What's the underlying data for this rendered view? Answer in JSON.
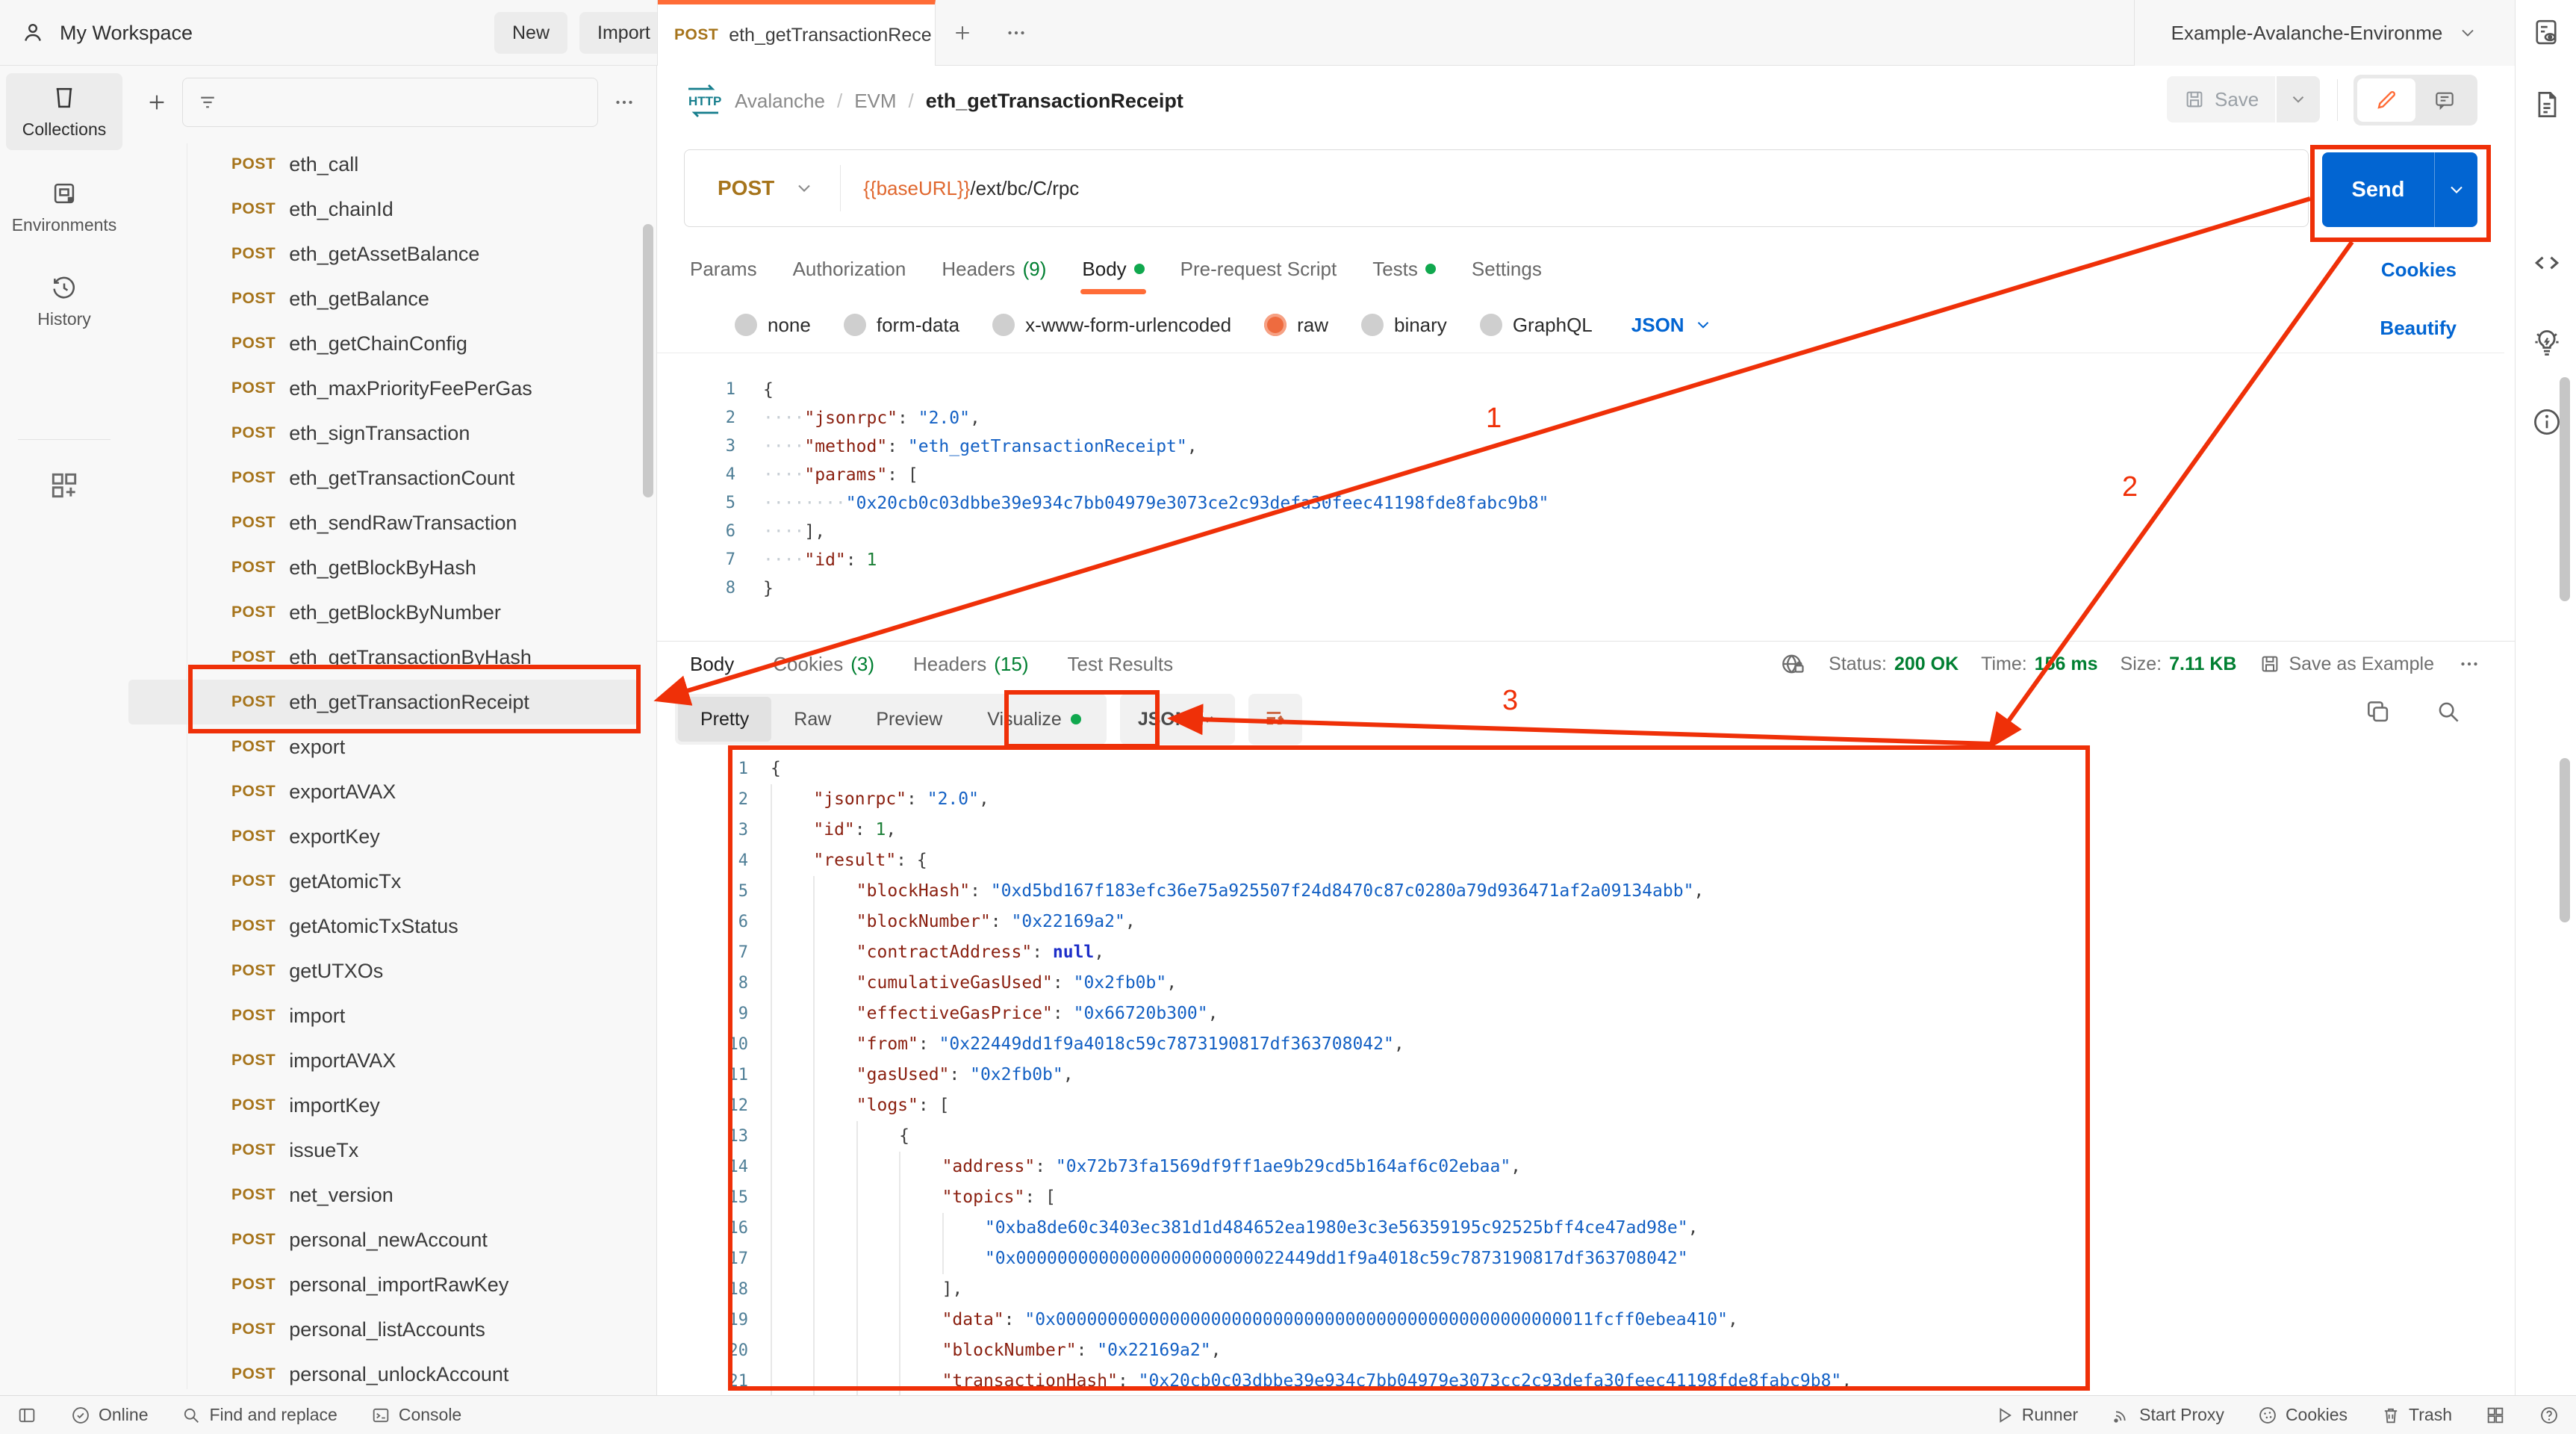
{
  "colors": {
    "accent_orange": "#ff6c37",
    "method_post_gold": "#a6741b",
    "link_blue": "#0265d2",
    "success_green": "#007f31",
    "dot_green": "#10a84e",
    "annotation_red": "#ef3008",
    "code_key": "#8a1f0f",
    "code_string": "#1360c4",
    "code_number": "#1b7f37",
    "code_null": "#1d2ec9"
  },
  "header": {
    "workspace_title": "My Workspace",
    "new_button": "New",
    "import_button": "Import",
    "active_tab": {
      "method": "POST",
      "title": "eth_getTransactionRece"
    },
    "environment": {
      "selected": "Example-Avalanche-Environme"
    }
  },
  "left_rail": {
    "collections": "Collections",
    "environments": "Environments",
    "history": "History"
  },
  "sidebar": {
    "selected_index": 12,
    "items": [
      {
        "method": "POST",
        "name": "eth_call"
      },
      {
        "method": "POST",
        "name": "eth_chainId"
      },
      {
        "method": "POST",
        "name": "eth_getAssetBalance"
      },
      {
        "method": "POST",
        "name": "eth_getBalance"
      },
      {
        "method": "POST",
        "name": "eth_getChainConfig"
      },
      {
        "method": "POST",
        "name": "eth_maxPriorityFeePerGas"
      },
      {
        "method": "POST",
        "name": "eth_signTransaction"
      },
      {
        "method": "POST",
        "name": "eth_getTransactionCount"
      },
      {
        "method": "POST",
        "name": "eth_sendRawTransaction"
      },
      {
        "method": "POST",
        "name": "eth_getBlockByHash"
      },
      {
        "method": "POST",
        "name": "eth_getBlockByNumber"
      },
      {
        "method": "POST",
        "name": "eth_getTransactionByHash"
      },
      {
        "method": "POST",
        "name": "eth_getTransactionReceipt"
      },
      {
        "method": "POST",
        "name": "export"
      },
      {
        "method": "POST",
        "name": "exportAVAX"
      },
      {
        "method": "POST",
        "name": "exportKey"
      },
      {
        "method": "POST",
        "name": "getAtomicTx"
      },
      {
        "method": "POST",
        "name": "getAtomicTxStatus"
      },
      {
        "method": "POST",
        "name": "getUTXOs"
      },
      {
        "method": "POST",
        "name": "import"
      },
      {
        "method": "POST",
        "name": "importAVAX"
      },
      {
        "method": "POST",
        "name": "importKey"
      },
      {
        "method": "POST",
        "name": "issueTx"
      },
      {
        "method": "POST",
        "name": "net_version"
      },
      {
        "method": "POST",
        "name": "personal_newAccount"
      },
      {
        "method": "POST",
        "name": "personal_importRawKey"
      },
      {
        "method": "POST",
        "name": "personal_listAccounts"
      },
      {
        "method": "POST",
        "name": "personal_unlockAccount"
      }
    ]
  },
  "request": {
    "breadcrumb": {
      "protocol": "HTTP",
      "part1": "Avalanche",
      "part2": "EVM",
      "current": "eth_getTransactionReceipt"
    },
    "save_button": "Save",
    "method": "POST",
    "url": {
      "variable": "{{baseURL}}",
      "path": "/ext/bc/C/rpc"
    },
    "send_button": "Send",
    "tabs": [
      {
        "label": "Params"
      },
      {
        "label": "Authorization"
      },
      {
        "label": "Headers",
        "count": "(9)"
      },
      {
        "label": "Body"
      },
      {
        "label": "Pre-request Script"
      },
      {
        "label": "Tests"
      },
      {
        "label": "Settings"
      }
    ],
    "cookies_link": "Cookies",
    "beautify_link": "Beautify",
    "body_modes": [
      {
        "label": "none"
      },
      {
        "label": "form-data"
      },
      {
        "label": "x-www-form-urlencoded"
      },
      {
        "label": "raw"
      },
      {
        "label": "binary"
      },
      {
        "label": "GraphQL"
      }
    ],
    "language": "JSON",
    "code": [
      {
        "n": 1,
        "i": 0,
        "s": [
          [
            "p",
            "{"
          ]
        ]
      },
      {
        "n": 2,
        "i": 1,
        "s": [
          [
            "k",
            "\"jsonrpc\""
          ],
          [
            "p",
            ": "
          ],
          [
            "s",
            "\"2.0\""
          ],
          [
            "p",
            ","
          ]
        ]
      },
      {
        "n": 3,
        "i": 1,
        "s": [
          [
            "k",
            "\"method\""
          ],
          [
            "p",
            ": "
          ],
          [
            "s",
            "\"eth_getTransactionReceipt\""
          ],
          [
            "p",
            ","
          ]
        ]
      },
      {
        "n": 4,
        "i": 1,
        "s": [
          [
            "k",
            "\"params\""
          ],
          [
            "p",
            ": "
          ],
          [
            "p",
            "["
          ]
        ]
      },
      {
        "n": 5,
        "i": 2,
        "s": [
          [
            "s",
            "\"0x20cb0c03dbbe39e934c7bb04979e3073ce2c93defa30feec41198fde8fabc9b8\""
          ]
        ]
      },
      {
        "n": 6,
        "i": 1,
        "s": [
          [
            "p",
            "],"
          ]
        ]
      },
      {
        "n": 7,
        "i": 1,
        "s": [
          [
            "k",
            "\"id\""
          ],
          [
            "p",
            ": "
          ],
          [
            "n",
            "1"
          ]
        ]
      },
      {
        "n": 8,
        "i": 0,
        "s": [
          [
            "p",
            "}"
          ]
        ]
      }
    ]
  },
  "response": {
    "tabs": [
      {
        "label": "Body"
      },
      {
        "label": "Cookies",
        "count": "(3)"
      },
      {
        "label": "Headers",
        "count": "(15)"
      },
      {
        "label": "Test Results"
      }
    ],
    "meta": {
      "status_label": "Status:",
      "status_value": "200 OK",
      "time_label": "Time:",
      "time_value": "156 ms",
      "size_label": "Size:",
      "size_value": "7.11 KB",
      "save_as_example": "Save as Example"
    },
    "views": [
      {
        "label": "Pretty"
      },
      {
        "label": "Raw"
      },
      {
        "label": "Preview"
      },
      {
        "label": "Visualize"
      }
    ],
    "language": "JSON",
    "code": [
      {
        "n": 1,
        "i": 0,
        "s": [
          [
            "p",
            "{"
          ]
        ]
      },
      {
        "n": 2,
        "i": 1,
        "s": [
          [
            "k",
            "\"jsonrpc\""
          ],
          [
            "p",
            ": "
          ],
          [
            "s",
            "\"2.0\""
          ],
          [
            "p",
            ","
          ]
        ]
      },
      {
        "n": 3,
        "i": 1,
        "s": [
          [
            "k",
            "\"id\""
          ],
          [
            "p",
            ": "
          ],
          [
            "n",
            "1"
          ],
          [
            "p",
            ","
          ]
        ]
      },
      {
        "n": 4,
        "i": 1,
        "s": [
          [
            "k",
            "\"result\""
          ],
          [
            "p",
            ": {"
          ]
        ]
      },
      {
        "n": 5,
        "i": 2,
        "s": [
          [
            "k",
            "\"blockHash\""
          ],
          [
            "p",
            ": "
          ],
          [
            "s",
            "\"0xd5bd167f183efc36e75a925507f24d8470c87c0280a79d936471af2a09134abb\""
          ],
          [
            "p",
            ","
          ]
        ]
      },
      {
        "n": 6,
        "i": 2,
        "s": [
          [
            "k",
            "\"blockNumber\""
          ],
          [
            "p",
            ": "
          ],
          [
            "s",
            "\"0x22169a2\""
          ],
          [
            "p",
            ","
          ]
        ]
      },
      {
        "n": 7,
        "i": 2,
        "s": [
          [
            "k",
            "\"contractAddress\""
          ],
          [
            "p",
            ": "
          ],
          [
            "u",
            "null"
          ],
          [
            "p",
            ","
          ]
        ]
      },
      {
        "n": 8,
        "i": 2,
        "s": [
          [
            "k",
            "\"cumulativeGasUsed\""
          ],
          [
            "p",
            ": "
          ],
          [
            "s",
            "\"0x2fb0b\""
          ],
          [
            "p",
            ","
          ]
        ]
      },
      {
        "n": 9,
        "i": 2,
        "s": [
          [
            "k",
            "\"effectiveGasPrice\""
          ],
          [
            "p",
            ": "
          ],
          [
            "s",
            "\"0x66720b300\""
          ],
          [
            "p",
            ","
          ]
        ]
      },
      {
        "n": 10,
        "i": 2,
        "s": [
          [
            "k",
            "\"from\""
          ],
          [
            "p",
            ": "
          ],
          [
            "s",
            "\"0x22449dd1f9a4018c59c7873190817df363708042\""
          ],
          [
            "p",
            ","
          ]
        ]
      },
      {
        "n": 11,
        "i": 2,
        "s": [
          [
            "k",
            "\"gasUsed\""
          ],
          [
            "p",
            ": "
          ],
          [
            "s",
            "\"0x2fb0b\""
          ],
          [
            "p",
            ","
          ]
        ]
      },
      {
        "n": 12,
        "i": 2,
        "s": [
          [
            "k",
            "\"logs\""
          ],
          [
            "p",
            ": ["
          ]
        ]
      },
      {
        "n": 13,
        "i": 3,
        "s": [
          [
            "p",
            "{"
          ]
        ]
      },
      {
        "n": 14,
        "i": 4,
        "s": [
          [
            "k",
            "\"address\""
          ],
          [
            "p",
            ": "
          ],
          [
            "s",
            "\"0x72b73fa1569df9ff1ae9b29cd5b164af6c02ebaa\""
          ],
          [
            "p",
            ","
          ]
        ]
      },
      {
        "n": 15,
        "i": 4,
        "s": [
          [
            "k",
            "\"topics\""
          ],
          [
            "p",
            ": ["
          ]
        ]
      },
      {
        "n": 16,
        "i": 5,
        "s": [
          [
            "s",
            "\"0xba8de60c3403ec381d1d484652ea1980e3c3e56359195c92525bff4ce47ad98e\""
          ],
          [
            "p",
            ","
          ]
        ]
      },
      {
        "n": 17,
        "i": 5,
        "s": [
          [
            "s",
            "\"0x00000000000000000000000022449dd1f9a4018c59c7873190817df363708042\""
          ]
        ]
      },
      {
        "n": 18,
        "i": 4,
        "s": [
          [
            "p",
            "],"
          ]
        ]
      },
      {
        "n": 19,
        "i": 4,
        "s": [
          [
            "k",
            "\"data\""
          ],
          [
            "p",
            ": "
          ],
          [
            "s",
            "\"0x0000000000000000000000000000000000000000000000000011fcff0ebea410\""
          ],
          [
            "p",
            ","
          ]
        ]
      },
      {
        "n": 20,
        "i": 4,
        "s": [
          [
            "k",
            "\"blockNumber\""
          ],
          [
            "p",
            ": "
          ],
          [
            "s",
            "\"0x22169a2\""
          ],
          [
            "p",
            ","
          ]
        ]
      },
      {
        "n": 21,
        "i": 4,
        "s": [
          [
            "k",
            "\"transactionHash\""
          ],
          [
            "p",
            ": "
          ],
          [
            "s",
            "\"0x20cb0c03dbbe39e934c7bb04979e3073cc2c93defa30feec41198fde8fabc9b8\""
          ],
          [
            "p",
            ","
          ]
        ]
      }
    ]
  },
  "status_bar": {
    "online": "Online",
    "find": "Find and replace",
    "console": "Console",
    "runner": "Runner",
    "start_proxy": "Start Proxy",
    "cookies": "Cookies",
    "trash": "Trash"
  },
  "annotations": {
    "step1": "1",
    "step2": "2",
    "step3": "3"
  }
}
